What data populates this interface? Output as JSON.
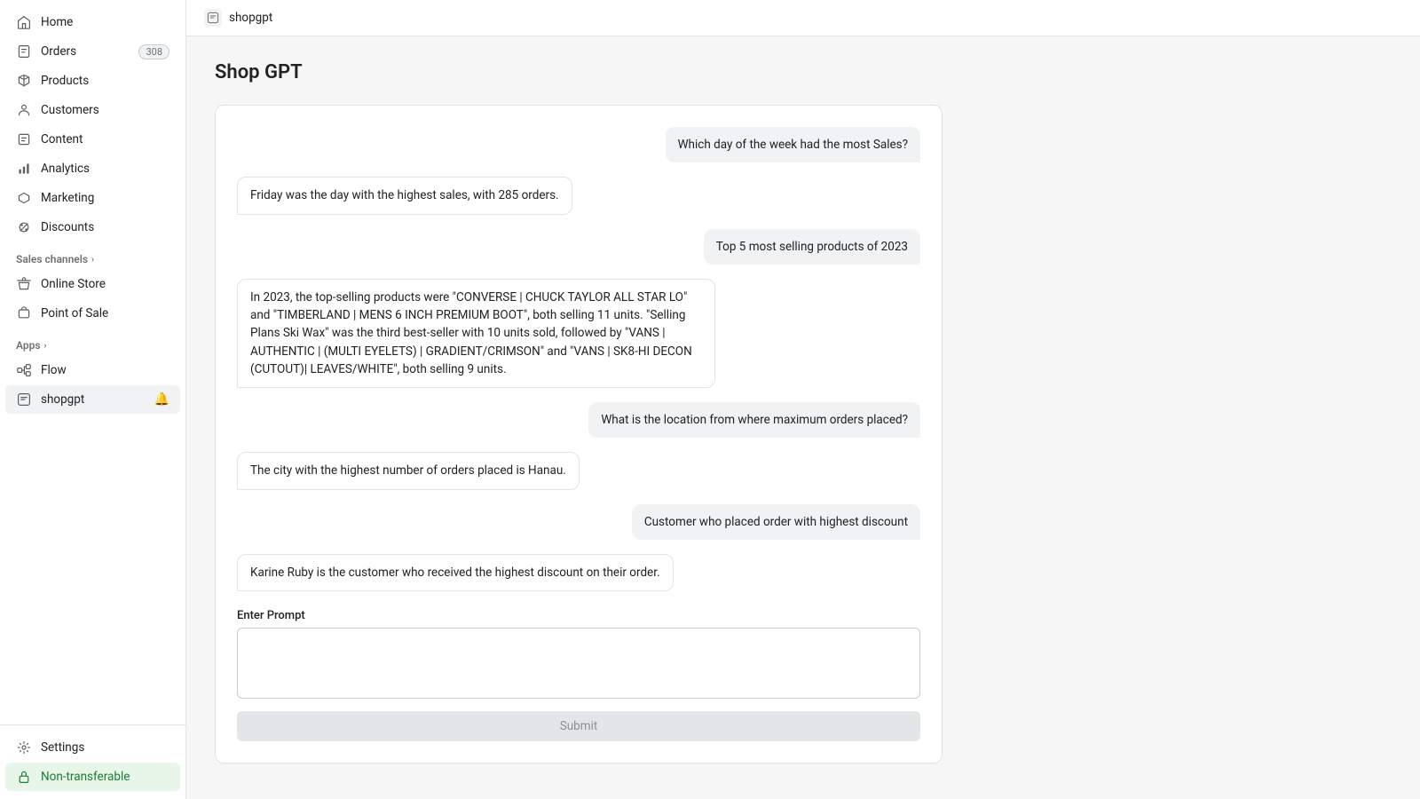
{
  "sidebar": {
    "nav_items": [
      {
        "id": "home",
        "label": "Home",
        "icon": "home"
      },
      {
        "id": "orders",
        "label": "Orders",
        "icon": "orders",
        "badge": "308"
      },
      {
        "id": "products",
        "label": "Products",
        "icon": "products"
      },
      {
        "id": "customers",
        "label": "Customers",
        "icon": "customers"
      },
      {
        "id": "content",
        "label": "Content",
        "icon": "content"
      },
      {
        "id": "analytics",
        "label": "Analytics",
        "icon": "analytics"
      },
      {
        "id": "marketing",
        "label": "Marketing",
        "icon": "marketing"
      },
      {
        "id": "discounts",
        "label": "Discounts",
        "icon": "discounts"
      }
    ],
    "sales_channels_label": "Sales channels",
    "sales_channels": [
      {
        "id": "online-store",
        "label": "Online Store",
        "icon": "store"
      },
      {
        "id": "point-of-sale",
        "label": "Point of Sale",
        "icon": "pos"
      }
    ],
    "apps_label": "Apps",
    "apps": [
      {
        "id": "flow",
        "label": "Flow",
        "icon": "flow"
      },
      {
        "id": "shopgpt",
        "label": "shopgpt",
        "icon": "shopgpt",
        "active": true
      }
    ],
    "bottom_items": [
      {
        "id": "settings",
        "label": "Settings",
        "icon": "settings"
      },
      {
        "id": "non-transferable",
        "label": "Non-transferable",
        "icon": "lock",
        "highlight": true
      }
    ]
  },
  "topbar": {
    "app_name": "shopgpt"
  },
  "page": {
    "title": "Shop GPT"
  },
  "chat": {
    "messages": [
      {
        "role": "user",
        "text": "Which day of the week had the most Sales?"
      },
      {
        "role": "bot",
        "text": "Friday was the day with the highest sales, with 285 orders."
      },
      {
        "role": "user",
        "text": "Top 5 most selling products of 2023"
      },
      {
        "role": "bot",
        "text": "In 2023, the top-selling products were \"CONVERSE | CHUCK TAYLOR ALL STAR LO\" and \"TIMBERLAND | MENS 6 INCH PREMIUM BOOT\", both selling 11 units. \"Selling Plans Ski Wax\" was the third best-seller with 10 units sold, followed by \"VANS | AUTHENTIC | (MULTI EYELETS) | GRADIENT/CRIMSON\" and \"VANS | SK8-HI DECON (CUTOUT)| LEAVES/WHITE\", both selling 9 units."
      },
      {
        "role": "user",
        "text": "What is the location from where maximum orders placed?"
      },
      {
        "role": "bot",
        "text": "The city with the highest number of orders placed is Hanau."
      },
      {
        "role": "user",
        "text": "Customer who placed order with highest discount"
      },
      {
        "role": "bot",
        "text": "Karine Ruby is the customer who received the highest discount on their order."
      }
    ],
    "prompt_label": "Enter Prompt",
    "prompt_placeholder": "",
    "submit_label": "Submit"
  }
}
